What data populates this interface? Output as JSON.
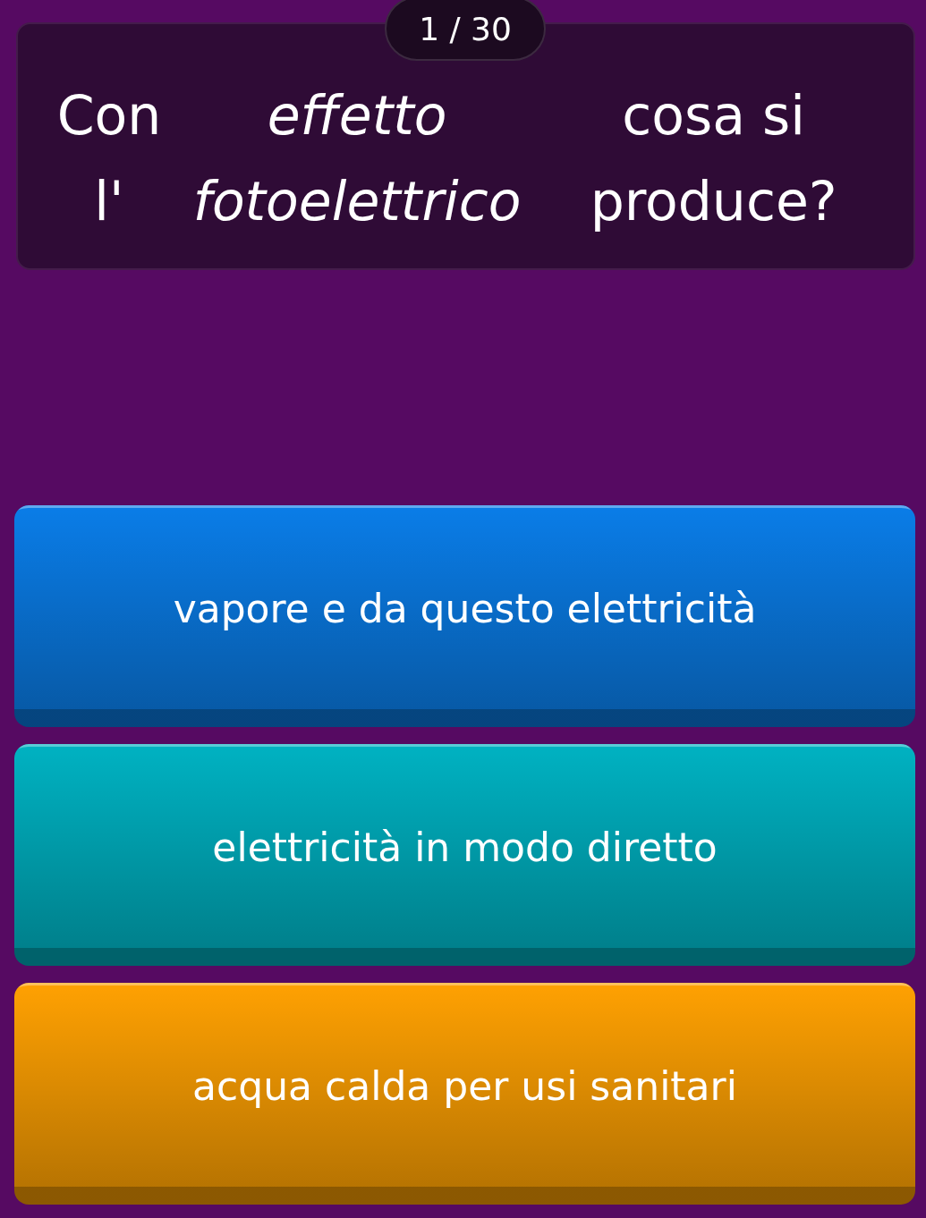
{
  "counter": "1 / 30",
  "question": "Con l' *effetto fotoelettrico* cosa si produce?",
  "answers": [
    {
      "text": "vapore e da questo elettricità",
      "color": "#0a7de8"
    },
    {
      "text": "elettricità in modo diretto",
      "color": "#00b2c2"
    },
    {
      "text": "acqua calda per usi sanitari",
      "color": "#ffa102"
    }
  ]
}
